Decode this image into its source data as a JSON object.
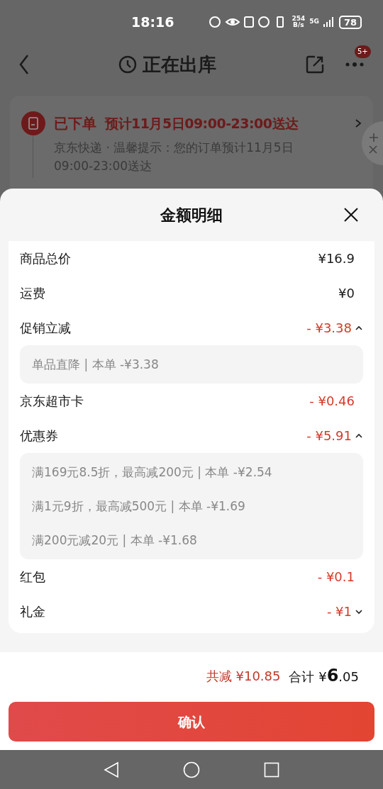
{
  "status_bar": {
    "time": "18:16",
    "net_speed": "254",
    "net_unit": "B/s",
    "network": "5G",
    "battery": "78"
  },
  "header": {
    "title": "正在出库",
    "badge": "5+"
  },
  "order_card": {
    "status": "已下单",
    "eta": "预计11月5日09:00-23:00送达",
    "note": "京东快递 · 温馨提示：您的订单预计11月5日09:00-23:00送达"
  },
  "sheet": {
    "title": "金额明细",
    "rows": [
      {
        "label": "商品总价",
        "amount": "¥16.9",
        "discount": false
      },
      {
        "label": "运费",
        "amount": "¥0",
        "discount": false
      },
      {
        "label": "促销立减",
        "amount": "- ¥3.38",
        "discount": true,
        "expanded": true,
        "details": [
          "单品直降 | 本单 -¥3.38"
        ]
      },
      {
        "label": "京东超市卡",
        "amount": "- ¥0.46",
        "discount": true
      },
      {
        "label": "优惠券",
        "amount": "- ¥5.91",
        "discount": true,
        "expanded": true,
        "details": [
          "满169元8.5折，最高减200元 | 本单 -¥2.54",
          "满1元9折，最高减500元 | 本单 -¥1.69",
          "满200元减20元 | 本单 -¥1.68"
        ]
      },
      {
        "label": "红包",
        "amount": "- ¥0.1",
        "discount": true
      },
      {
        "label": "礼金",
        "amount": "- ¥1",
        "discount": true,
        "expanded": false
      }
    ],
    "saved": "共减 ¥10.85",
    "total_label": "合计",
    "total_currency": "¥",
    "total_integer": "6",
    "total_fraction": ".05",
    "confirm": "确认"
  }
}
